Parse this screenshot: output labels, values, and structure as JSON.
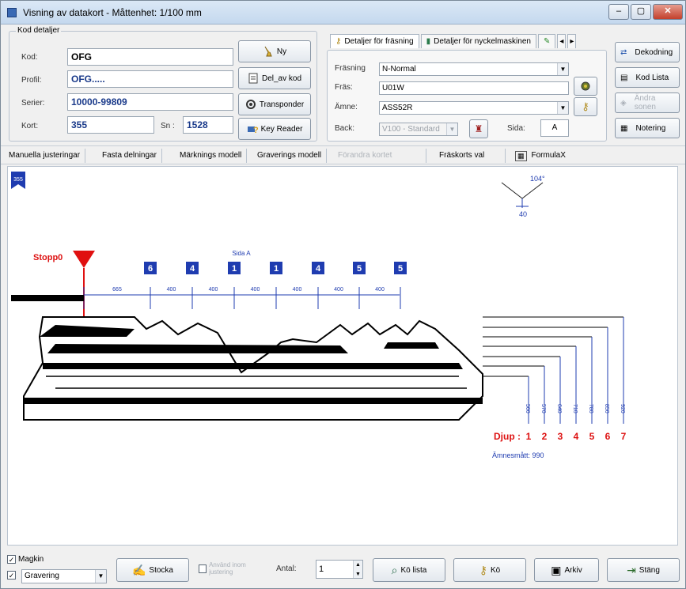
{
  "window": {
    "title": "Visning av datakort - Måttenhet: 1/100 mm",
    "controls": [
      "–",
      "▢",
      "✕"
    ]
  },
  "kod_detaljer": {
    "group_label": "Kod detaljer",
    "kod_label": "Kod:",
    "kod_value": "OFG",
    "profil_label": "Profil:",
    "profil_value": "OFG.....",
    "serier_label": "Serier:",
    "serier_value": "10000-99809",
    "kort_label": "Kort:",
    "kort_value": "355",
    "sn_label": "Sn :",
    "sn_value": "1528"
  },
  "middle_buttons": {
    "ny": "Ny",
    "del_av_kod": "Del_av kod",
    "transponder": "Transponder",
    "key_reader": "Key Reader"
  },
  "detail_tabs": {
    "tab1": "Detaljer för fräsning",
    "tab2": "Detaljer för nyckelmaskinen"
  },
  "fraesning": {
    "fraesning_label": "Fräsning",
    "fraesning_value": "N-Normal",
    "fras_label": "Fräs:",
    "fras_value": "U01W",
    "aemne_label": "Ämne:",
    "aemne_value": "ASS52R",
    "back_label": "Back:",
    "back_value": "V100 - Standard",
    "sida_label": "Sida:",
    "sida_value": "A"
  },
  "right_buttons": {
    "dekodning": "Dekodning",
    "kod_lista": "Kod Lista",
    "andra_sonen": "Ändra sonen",
    "notering": "Notering"
  },
  "modebar": {
    "items": [
      "Manuella justeringar",
      "Fasta delningar",
      "Märknings modell",
      "Graverings modell",
      "Förandra kortet",
      "Fräskorts val",
      "FormulaX"
    ]
  },
  "key_drawing": {
    "card_badge": "355",
    "stop_label": "Stopp0",
    "side_label": "Sida A",
    "angle_label": "104°",
    "angle_width": "40",
    "cut_codes": [
      "6",
      "4",
      "1",
      "1",
      "4",
      "5",
      "5"
    ],
    "spacing_first": "665",
    "spacing_values": [
      "400",
      "400",
      "400",
      "400",
      "400",
      "400"
    ],
    "depth_title": "Djup :",
    "depth_numbers": [
      "1",
      "2",
      "3",
      "4",
      "5",
      "6",
      "7"
    ],
    "depth_values": [
      "500",
      "570",
      "640",
      "710",
      "780",
      "850",
      "920"
    ],
    "annesmatt": "Ämnesmått: 990"
  },
  "bottom": {
    "magkin_label": "Magkin",
    "gravering_value": "Gravering",
    "stocka_label": "Stocka",
    "anvand_label": "Använd inom justering",
    "antal_label": "Antal:",
    "antal_value": "1",
    "ko_lista": "Kö lista",
    "ko": "Kö",
    "arkiv": "Arkiv",
    "stang": "Stäng"
  }
}
